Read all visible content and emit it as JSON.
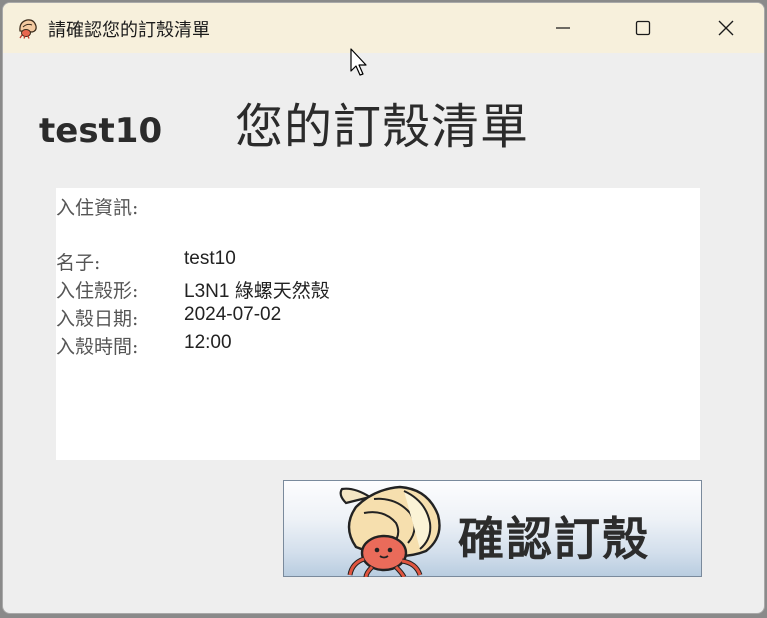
{
  "window": {
    "title": "請確認您的訂殼清單"
  },
  "header": {
    "username": "test10",
    "title": "您的訂殼清單"
  },
  "info": {
    "heading": "入住資訊:",
    "rows": [
      {
        "label": "名子:",
        "value": "test10"
      },
      {
        "label": "入住殼形:",
        "value": "L3N1 綠螺天然殼"
      },
      {
        "label": "入殼日期:",
        "value": "2024-07-02"
      },
      {
        "label": "入殼時間:",
        "value": "12:00"
      }
    ]
  },
  "actions": {
    "confirm_label": "確認訂殼",
    "confirm_icon": "hermit-crab-icon"
  },
  "colors": {
    "titlebar_bg": "#f7f0dc",
    "window_bg": "#eeeeee",
    "panel_bg": "#ffffff"
  }
}
